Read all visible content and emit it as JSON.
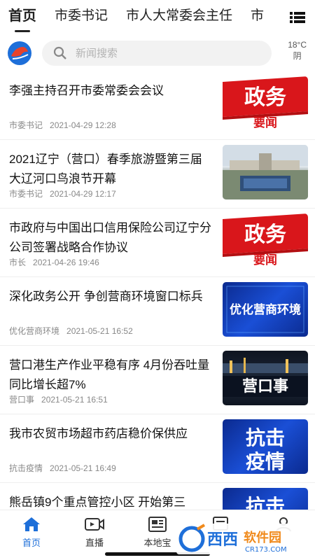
{
  "tabs": [
    "首页",
    "市委书记",
    "市人大常委会主任",
    "市"
  ],
  "search": {
    "placeholder": "新闻搜索"
  },
  "weather": {
    "temp": "18°C",
    "condition": "阴"
  },
  "news": [
    {
      "title": "李强主持召开市委常委会会议",
      "source": "市委书记",
      "time": "2021-04-29 12:28",
      "thumb": "政务要闻"
    },
    {
      "title": "2021辽宁（营口）春季旅游暨第三届大辽河口鸟浪节开幕",
      "source": "市委书记",
      "time": "2021-04-29 12:17",
      "thumb": "photo"
    },
    {
      "title": "市政府与中国出口信用保险公司辽宁分公司签署战略合作协议",
      "source": "市长",
      "time": "2021-04-26 19:46",
      "thumb": "政务要闻"
    },
    {
      "title": "深化政务公开 争创营商环境窗口标兵",
      "source": "优化营商环境",
      "time": "2021-05-21 16:52",
      "thumb": "优化营商环境"
    },
    {
      "title": "营口港生产作业平稳有序 4月份吞吐量同比增长超7%",
      "source": "营口事",
      "time": "2021-05-21 16:51",
      "thumb": "营口事"
    },
    {
      "title": "我市农贸市场超市药店稳价保供应",
      "source": "抗击疫情",
      "time": "2021-05-21 16:49",
      "thumb": "抗击疫情"
    },
    {
      "title": "熊岳镇9个重点管控小区 开始第三",
      "source": "",
      "time": "",
      "thumb": "抗击"
    }
  ],
  "thumb_text": {
    "zw_top": "政务",
    "zw_bottom": "要闻",
    "yh": "优化营商环境",
    "yk": "营口事",
    "kj_top": "抗击",
    "kj_bottom": "疫情"
  },
  "bottom_nav": [
    {
      "label": "首页",
      "icon": "home-icon",
      "active": true
    },
    {
      "label": "直播",
      "icon": "video-icon",
      "active": false
    },
    {
      "label": "本地宝",
      "icon": "newspaper-icon",
      "active": false
    },
    {
      "label": "",
      "icon": "layers-icon",
      "active": false
    },
    {
      "label": "",
      "icon": "user-icon",
      "active": false
    }
  ],
  "watermark": {
    "brand": "西西",
    "suffix": "软件园",
    "domain": "CR173.COM"
  },
  "colors": {
    "accent": "#1e6fd9",
    "red": "#d9161b"
  }
}
